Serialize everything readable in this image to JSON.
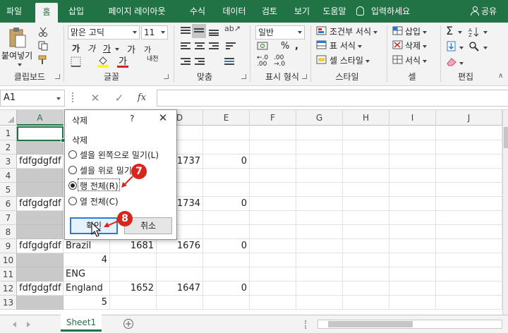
{
  "ribbon_tabs": [
    "파일",
    "홈",
    "삽입",
    "페이지 레이아웃",
    "수식",
    "데이터",
    "검토",
    "보기",
    "도움말"
  ],
  "tell_me": "입력하세요",
  "share": "공유",
  "clipboard": {
    "paste": "붙여넣기",
    "label": "클립보드"
  },
  "font": {
    "name": "맑은 고딕",
    "size": "11",
    "grow": "가",
    "shrink": "가",
    "bold": "가",
    "italic": "가",
    "underline": "가",
    "phonetic": "내천",
    "label": "글꼴"
  },
  "alignment": {
    "label": "맞춤"
  },
  "number": {
    "format": "일반",
    "label": "표시 형식"
  },
  "styles": {
    "conditional": "조건부 서식",
    "table": "표 서식",
    "cell": "셀 스타일",
    "label": "스타일"
  },
  "cells": {
    "insert": "삽입",
    "delete": "삭제",
    "format": "서식",
    "label": "셀"
  },
  "editing": {
    "label": "편집"
  },
  "formula_bar": {
    "name_box": "A1",
    "fx": "fx",
    "value": ""
  },
  "columns": [
    "A",
    "B",
    "C",
    "D",
    "E",
    "F",
    "G",
    "H",
    "I",
    "J"
  ],
  "rows": [
    {
      "n": "1",
      "a": "",
      "b": "",
      "c": "",
      "d": "",
      "e": ""
    },
    {
      "n": "2",
      "a": "",
      "b": "",
      "c": "",
      "d": "",
      "e": ""
    },
    {
      "n": "3",
      "a": "fdfgdgfdf",
      "b": "",
      "c": "",
      "d": "1737",
      "e": "0"
    },
    {
      "n": "4",
      "a": "",
      "b": "",
      "c": "",
      "d": "",
      "e": ""
    },
    {
      "n": "5",
      "a": "",
      "b": "",
      "c": "",
      "d": "",
      "e": ""
    },
    {
      "n": "6",
      "a": "fdfgdgfdf",
      "b": "",
      "c": "",
      "d": "1734",
      "e": "0"
    },
    {
      "n": "7",
      "a": "",
      "b": "",
      "c": "",
      "d": "",
      "e": ""
    },
    {
      "n": "8",
      "a": "",
      "b": "",
      "c": "",
      "d": "",
      "e": ""
    },
    {
      "n": "9",
      "a": "fdfgdgfdf",
      "b": "Brazil",
      "c": "1681",
      "d": "1676",
      "e": "0"
    },
    {
      "n": "10",
      "a": "",
      "b": "4",
      "c": "",
      "d": "",
      "e": ""
    },
    {
      "n": "11",
      "a": "",
      "b": "ENG",
      "c": "",
      "d": "",
      "e": ""
    },
    {
      "n": "12",
      "a": "fdfgdgfdf",
      "b": "England",
      "c": "1652",
      "d": "1647",
      "e": "0"
    },
    {
      "n": "13",
      "a": "",
      "b": "5",
      "c": "",
      "d": "",
      "e": ""
    }
  ],
  "sheet_tab": "Sheet1",
  "dialog": {
    "title": "삭제",
    "help": "?",
    "group_label": "삭제",
    "options": [
      "셀을 왼쪽으로 밀기(L)",
      "셀을 위로 밀기(U)",
      "행 전체(R)",
      "열 전체(C)"
    ],
    "selected": "행 전체(R)",
    "ok": "확인",
    "cancel": "취소"
  },
  "callouts": [
    "7",
    "8"
  ],
  "colors": {
    "excel_green": "#217346",
    "callout_red": "#d9261c",
    "shaded_cells": "#c9c9c9"
  }
}
